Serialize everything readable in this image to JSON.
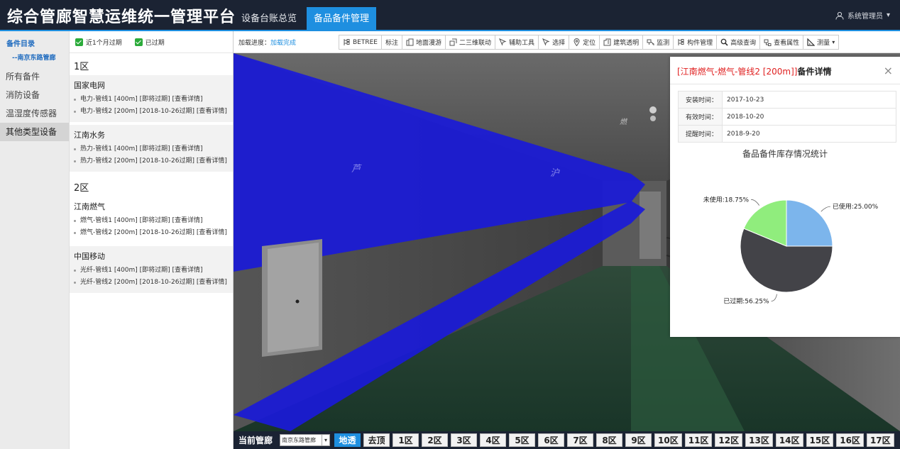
{
  "header": {
    "app_title": "综合管廊智慧运维统一管理平台",
    "tabs": [
      {
        "label": "设备台账总览"
      },
      {
        "label": "备品备件管理"
      }
    ],
    "user_name": "系统管理员"
  },
  "sidebar": {
    "catalog_title": "备件目录",
    "catalog_sub": "--南京东路管廊",
    "items": [
      {
        "label": "所有备件"
      },
      {
        "label": "消防设备"
      },
      {
        "label": "温湿度传感器"
      },
      {
        "label": "其他类型设备"
      }
    ]
  },
  "filters": {
    "expire_soon": "近1个月过期",
    "expired": "已过期"
  },
  "zones": [
    {
      "name": "1区",
      "groups": [
        {
          "name": "国家电网",
          "items": [
            "电力-管线1 [400m] [即将过期] [查看详情]",
            "电力-管线2 [200m] [2018-10-26过期] [查看详情]"
          ]
        },
        {
          "name": "江南水务",
          "items": [
            "热力-管线1 [400m] [即将过期] [查看详情]",
            "热力-管线2 [200m] [2018-10-26过期] [查看详情]"
          ]
        }
      ]
    },
    {
      "name": "2区",
      "groups": [
        {
          "name": "江南燃气",
          "items": [
            "燃气-管线1 [400m] [即将过期] [查看详情]",
            "燃气-管线2 [200m] [2018-10-26过期] [查看详情]"
          ]
        },
        {
          "name": "中国移动",
          "items": [
            "光纤-管线1 [400m] [即将过期] [查看详情]",
            "光纤-管线2 [200m] [2018-10-26过期] [查看详情]"
          ]
        }
      ]
    }
  ],
  "toolbar": {
    "progress_label": "加载进度：",
    "progress_value": "加载完成",
    "tools": [
      {
        "label": "BETREE",
        "icon": "tree-icon"
      },
      {
        "label": "标注",
        "icon": "none"
      },
      {
        "label": "地面漫游",
        "icon": "roam-icon"
      },
      {
        "label": "二三维联动",
        "icon": "link-icon"
      },
      {
        "label": "辅助工具",
        "icon": "pointer-icon"
      },
      {
        "label": "选择",
        "icon": "pointer-icon"
      },
      {
        "label": "定位",
        "icon": "pin-icon"
      },
      {
        "label": "建筑透明",
        "icon": "building-icon"
      },
      {
        "label": "监测",
        "icon": "monitor-icon"
      },
      {
        "label": "构件管理",
        "icon": "tree-icon"
      },
      {
        "label": "高级查询",
        "icon": "search-icon"
      },
      {
        "label": "查看属性",
        "icon": "property-icon"
      },
      {
        "label": "测量",
        "icon": "ruler-icon"
      }
    ]
  },
  "scene": {
    "labels": [
      "芦",
      "沪",
      "燃"
    ]
  },
  "detail": {
    "title_highlight": "[江南燃气-燃气-管线2 [200m]]",
    "title_suffix": "备件详情",
    "rows": [
      {
        "key": "安装时间：",
        "value": "2017-10-23"
      },
      {
        "key": "有效时间：",
        "value": "2018-10-20"
      },
      {
        "key": "提醒时间：",
        "value": "2018-9-20"
      }
    ],
    "chart_title": "备品备件库存情况统计"
  },
  "chart_data": {
    "type": "pie",
    "title": "备品备件库存情况统计",
    "slices": [
      {
        "label": "已使用",
        "value": 25.0,
        "text": "已使用:25.00%",
        "color": "#7cb5ec"
      },
      {
        "label": "已过期",
        "value": 56.25,
        "text": "已过期:56.25%",
        "color": "#434348"
      },
      {
        "label": "未使用",
        "value": 18.75,
        "text": "未使用:18.75%",
        "color": "#90ed7d"
      }
    ]
  },
  "bottombar": {
    "label": "当前管廊",
    "select_value": "南京东路管廊",
    "buttons": [
      "地透",
      "去顶",
      "1区",
      "2区",
      "3区",
      "4区",
      "5区",
      "6区",
      "7区",
      "8区",
      "9区",
      "10区",
      "11区",
      "12区",
      "13区",
      "14区",
      "15区",
      "16区",
      "17区"
    ]
  },
  "colors": {
    "header_bg": "#1b2333",
    "accent": "#1e8fe0",
    "pipe_blue": "#1a1ad8",
    "title_red": "#e02020"
  }
}
